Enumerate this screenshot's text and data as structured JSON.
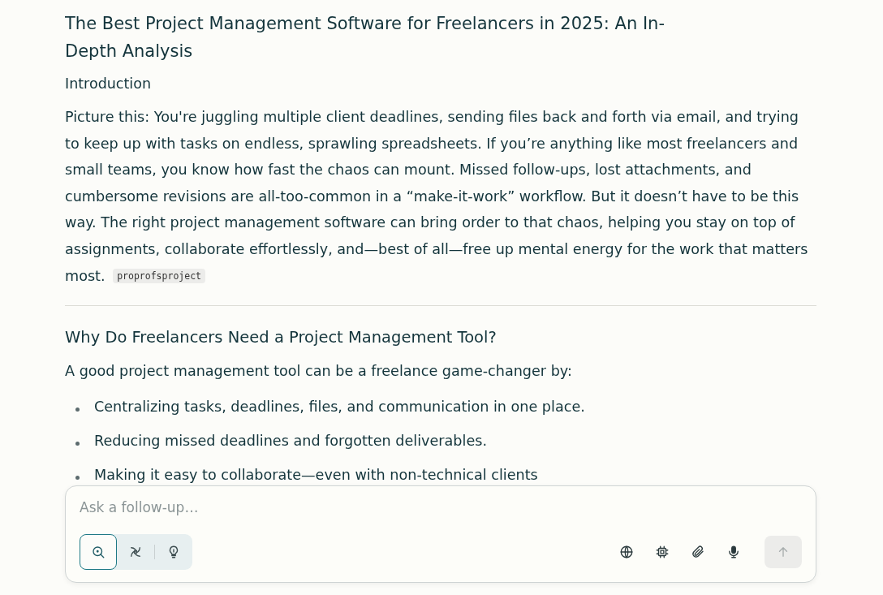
{
  "article": {
    "title": "The Best Project Management Software for Freelancers in 2025: An In-Depth Analysis",
    "sections": [
      {
        "heading": "Introduction",
        "kind": "subheading",
        "paragraph": "Picture this: You're juggling multiple client deadlines, sending files back and forth via email, and trying to keep up with tasks on endless, sprawling spreadsheets. If you’re anything like most freelancers and small teams, you know how fast the chaos can mount. Missed follow-ups, lost attachments, and cumbersome revisions are all-too-common in a “make-it-work” workflow. But it doesn’t have to be this way. The right project management software can bring order to that chaos, helping you stay on top of assignments, collaborate effortlessly, and—best of all—free up mental energy for the work that matters most.",
        "citation": "proprofsproject",
        "divider_after": true
      },
      {
        "heading": "Why Do Freelancers Need a Project Management Tool?",
        "kind": "heading",
        "paragraph": "A good project management tool can be a freelance game-changer by:",
        "bullets": [
          "Centralizing tasks, deadlines, files, and communication in one place.",
          "Reducing missed deadlines and forgotten deliverables.",
          "Making it easy to collaborate—even with non-technical clients"
        ]
      }
    ]
  },
  "composer": {
    "placeholder": "Ask a follow-up…",
    "modes": [
      {
        "kind": "search",
        "selected": true
      },
      {
        "kind": "research",
        "selected": false
      },
      {
        "kind": "reasoning",
        "selected": false
      }
    ],
    "tools": [
      {
        "kind": "globe"
      },
      {
        "kind": "chip"
      },
      {
        "kind": "attach"
      },
      {
        "kind": "mic"
      }
    ],
    "send": {
      "disabled": true
    }
  }
}
